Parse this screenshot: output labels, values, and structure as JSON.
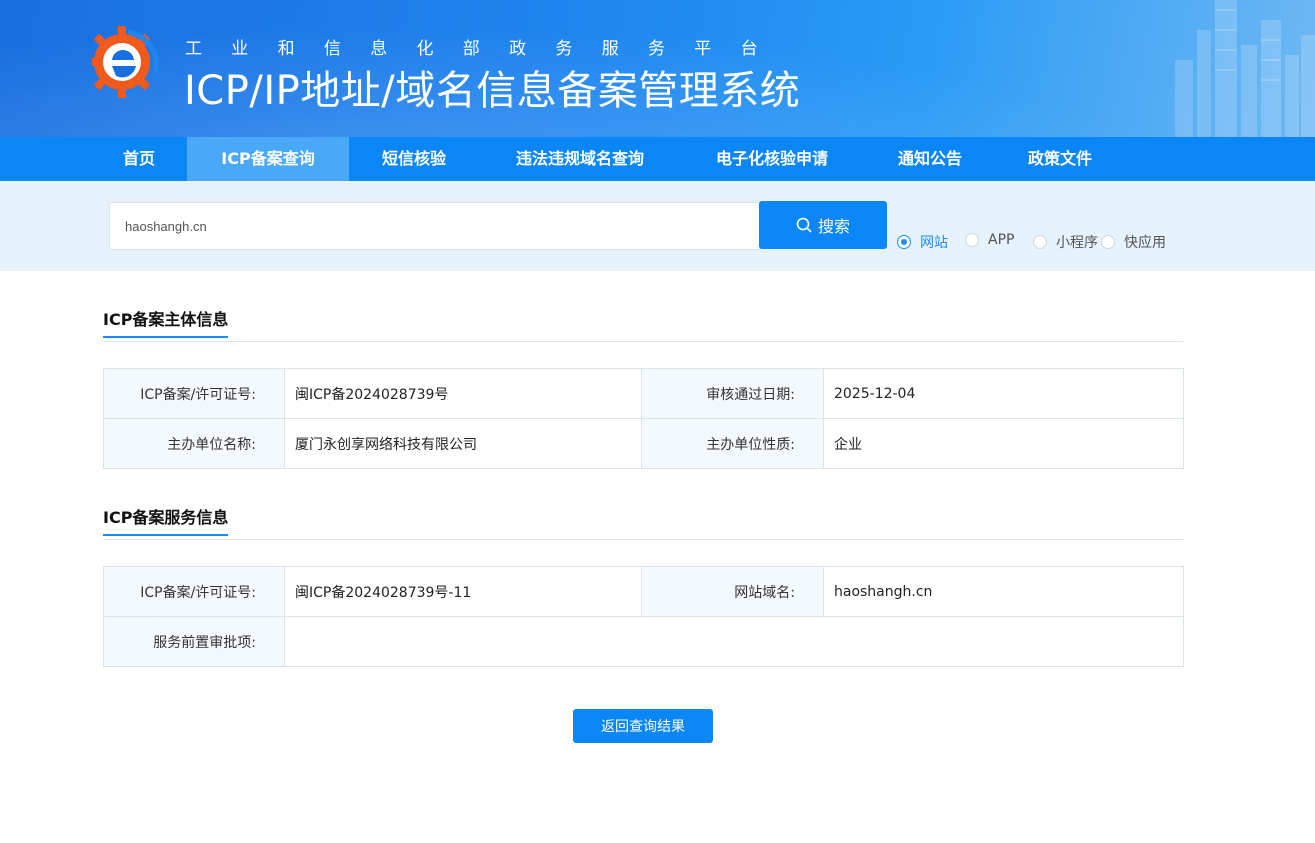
{
  "header": {
    "subtitle": "工业和信息化部政务服务平台",
    "title": "ICP/IP地址/域名信息备案管理系统"
  },
  "nav": {
    "items": [
      {
        "label": "首页"
      },
      {
        "label": "ICP备案查询"
      },
      {
        "label": "短信核验"
      },
      {
        "label": "违法违规域名查询"
      },
      {
        "label": "电子化核验申请"
      },
      {
        "label": "通知公告"
      },
      {
        "label": "政策文件"
      }
    ],
    "active": "ICP备案查询"
  },
  "search": {
    "value": "haoshangh.cn",
    "button_label": "搜索",
    "options": [
      {
        "label": "网站",
        "checked": true
      },
      {
        "label": "APP",
        "checked": false
      },
      {
        "label": "小程序",
        "checked": false
      },
      {
        "label": "快应用",
        "checked": false
      }
    ]
  },
  "subject_info": {
    "title": "ICP备案主体信息",
    "license_label": "ICP备案/许可证号:",
    "license_value": "闽ICP备2024028739号",
    "approval_date_label": "审核通过日期:",
    "approval_date_value": "2025-12-04",
    "org_name_label": "主办单位名称:",
    "org_name_value": "厦门永创享网络科技有限公司",
    "org_type_label": "主办单位性质:",
    "org_type_value": "企业"
  },
  "service_info": {
    "title": "ICP备案服务信息",
    "license_label": "ICP备案/许可证号:",
    "license_value": "闽ICP备2024028739号-11",
    "domain_label": "网站域名:",
    "domain_value": "haoshangh.cn",
    "preapproval_label": "服务前置审批项:",
    "preapproval_value": ""
  },
  "back_button_label": "返回查询结果",
  "colors": {
    "primary": "#0a86f6",
    "nav_active": "#4aa8f8",
    "search_band": "#e6f2fc",
    "label_cell": "#f4f9fd"
  },
  "icons": {
    "logo": "e-gear-logo",
    "search": "search-icon"
  }
}
